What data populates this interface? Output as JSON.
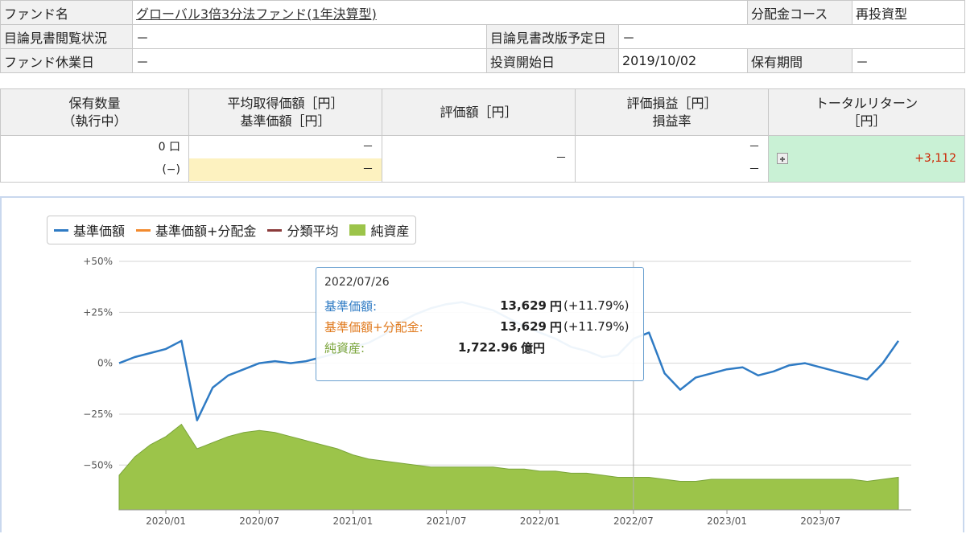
{
  "info": {
    "fund_name_label": "ファンド名",
    "fund_name": "グローバル3倍3分法ファンド(1年決算型)",
    "dist_course_label": "分配金コース",
    "dist_course": "再投資型",
    "prospectus_status_label": "目論見書閲覧状況",
    "prospectus_status": "－",
    "prospectus_revision_label": "目論見書改版予定日",
    "prospectus_revision": "－",
    "holiday_label": "ファンド休業日",
    "holiday": "－",
    "start_date_label": "投資開始日",
    "start_date": "2019/10/02",
    "holding_period_label": "保有期間",
    "holding_period": "－"
  },
  "holdings": {
    "headers": {
      "qty": [
        "保有数量",
        "（執行中）"
      ],
      "avg": [
        "平均取得価額［円］",
        "基準価額［円］"
      ],
      "value": [
        "評価額［円］"
      ],
      "pnl": [
        "評価損益［円］",
        "損益率"
      ],
      "total": [
        "トータルリターン",
        "［円］"
      ]
    },
    "qty": "0 口",
    "qty_pending": "(−)",
    "avg_cost": "－",
    "nav": "－",
    "value": "－",
    "pnl": "－",
    "pnl_rate": "－",
    "total_return": "+3,112"
  },
  "legend": [
    {
      "label": "基準価額",
      "color": "#2f7bc4",
      "kind": "line"
    },
    {
      "label": "基準価額+分配金",
      "color": "#f28a2e",
      "kind": "line"
    },
    {
      "label": "分類平均",
      "color": "#8b3a3a",
      "kind": "line"
    },
    {
      "label": "純資産",
      "color": "#9cc44a",
      "kind": "area"
    }
  ],
  "tooltip": {
    "date": "2022/07/26",
    "rows": [
      {
        "label": "基準価額:",
        "value": "13,629",
        "unit": "円",
        "pct": "(+11.79%)",
        "color": "#2f7bc4"
      },
      {
        "label": "基準価額+分配金:",
        "value": "13,629",
        "unit": "円",
        "pct": "(+11.79%)",
        "color": "#e07a1e"
      },
      {
        "label": "純資産:",
        "value": "1,722.96",
        "unit": "億円",
        "pct": "",
        "color": "#7aa43a"
      }
    ]
  },
  "chart_data": {
    "type": "line",
    "y_ticks": [
      "+50%",
      "+25%",
      "0%",
      "−25%",
      "−50%"
    ],
    "x_ticks": [
      "2020/01",
      "2020/07",
      "2021/01",
      "2021/07",
      "2022/01",
      "2022/07",
      "2023/01",
      "2023/07"
    ],
    "ylim": [
      -72,
      50
    ],
    "series": [
      {
        "name": "基準価額",
        "x": [
          "2019/10",
          "2019/11",
          "2019/12",
          "2020/01",
          "2020/02",
          "2020/03",
          "2020/04",
          "2020/05",
          "2020/06",
          "2020/07",
          "2020/08",
          "2020/09",
          "2020/10",
          "2020/11",
          "2020/12",
          "2021/01",
          "2021/02",
          "2021/03",
          "2021/04",
          "2021/05",
          "2021/06",
          "2021/07",
          "2021/08",
          "2021/09",
          "2021/10",
          "2021/11",
          "2021/12",
          "2022/01",
          "2022/02",
          "2022/03",
          "2022/04",
          "2022/05",
          "2022/06",
          "2022/07",
          "2022/08",
          "2022/09",
          "2022/10",
          "2022/11",
          "2022/12",
          "2023/01",
          "2023/02",
          "2023/03",
          "2023/04",
          "2023/05",
          "2023/06",
          "2023/07",
          "2023/08",
          "2023/09",
          "2023/10",
          "2023/11",
          "2023/12"
        ],
        "values": [
          0,
          3,
          5,
          7,
          11,
          -28,
          -12,
          -6,
          -3,
          0,
          1,
          0,
          1,
          3,
          5,
          8,
          10,
          14,
          20,
          24,
          27,
          29,
          30,
          28,
          26,
          22,
          18,
          15,
          12,
          8,
          6,
          3,
          4,
          12,
          15,
          -5,
          -13,
          -7,
          -5,
          -3,
          -2,
          -6,
          -4,
          -1,
          0,
          -2,
          -4,
          -6,
          -8,
          0,
          11
        ]
      },
      {
        "name": "純資産",
        "x": [
          "2019/10",
          "2019/11",
          "2019/12",
          "2020/01",
          "2020/02",
          "2020/03",
          "2020/04",
          "2020/05",
          "2020/06",
          "2020/07",
          "2020/08",
          "2020/09",
          "2020/10",
          "2020/11",
          "2020/12",
          "2021/01",
          "2021/02",
          "2021/03",
          "2021/04",
          "2021/05",
          "2021/06",
          "2021/07",
          "2021/08",
          "2021/09",
          "2021/10",
          "2021/11",
          "2021/12",
          "2022/01",
          "2022/02",
          "2022/03",
          "2022/04",
          "2022/05",
          "2022/06",
          "2022/07",
          "2022/08",
          "2022/09",
          "2022/10",
          "2022/11",
          "2022/12",
          "2023/01",
          "2023/02",
          "2023/03",
          "2023/04",
          "2023/05",
          "2023/06",
          "2023/07",
          "2023/08",
          "2023/09",
          "2023/10",
          "2023/11",
          "2023/12"
        ],
        "values": [
          -55,
          -46,
          -40,
          -36,
          -30,
          -42,
          -39,
          -36,
          -34,
          -33,
          -34,
          -36,
          -38,
          -40,
          -42,
          -45,
          -47,
          -48,
          -49,
          -50,
          -51,
          -51,
          -51,
          -51,
          -51,
          -52,
          -52,
          -53,
          -53,
          -54,
          -54,
          -55,
          -56,
          -56,
          -56,
          -57,
          -58,
          -58,
          -57,
          -57,
          -57,
          -57,
          -57,
          -57,
          -57,
          -57,
          -57,
          -57,
          -58,
          -57,
          -56
        ]
      }
    ]
  }
}
